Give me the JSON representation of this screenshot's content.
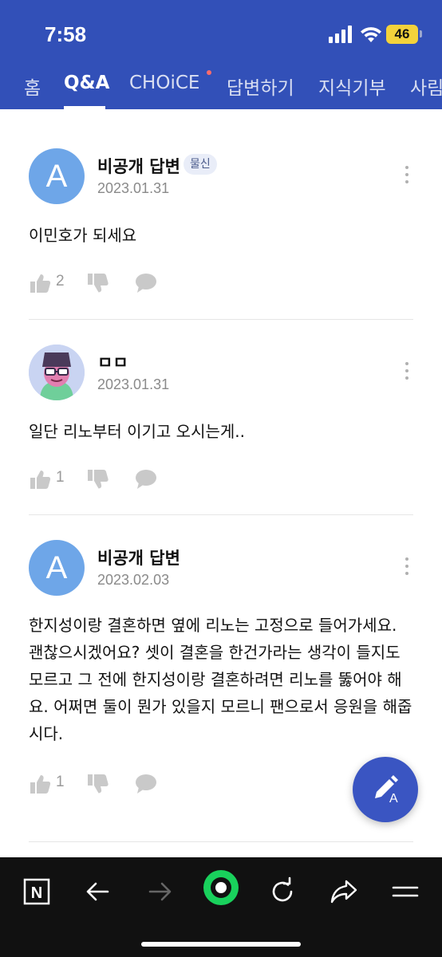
{
  "status_bar": {
    "time": "7:58",
    "battery": "46"
  },
  "tabs": [
    {
      "label": "홈",
      "active": false
    },
    {
      "label": "Q&A",
      "active": true
    },
    {
      "label": "CHOiCE",
      "active": false,
      "new_dot": true
    },
    {
      "label": "답변하기",
      "active": false
    },
    {
      "label": "지식기부",
      "active": false
    },
    {
      "label": "사림",
      "active": false
    }
  ],
  "answers": [
    {
      "avatar_letter": "A",
      "name": "비공개 답변",
      "badge": "물신",
      "date": "2023.01.31",
      "content": "이민호가 되세요",
      "likes": "2"
    },
    {
      "avatar_letter": "",
      "name": "ㅁㅁ",
      "badge": "",
      "date": "2023.01.31",
      "content": "일단 리노부터 이기고 오시는게..",
      "likes": "1"
    },
    {
      "avatar_letter": "A",
      "name": "비공개 답변",
      "badge": "",
      "date": "2023.02.03",
      "content": "한지성이랑 결혼하면 옆에 리노는 고정으로 들어가세요. 괜찮으시겠어요? 셋이 결혼을 한건가라는 생각이 들지도 모르고 그 전에 한지성이랑 결혼하려면 리노를 뚫어야 해요. 어쩌면 둘이 뭔가 있을지 모르니 팬으로서 응원을 해줍시다.",
      "likes": "1"
    }
  ],
  "fab": {
    "icon": "write-answer-icon",
    "letter": "A"
  },
  "toolbar": {
    "items": [
      "naver-n-icon",
      "back-icon",
      "forward-icon",
      "green-dot-icon",
      "reload-icon",
      "share-icon",
      "menu-icon"
    ],
    "n_label": "N"
  },
  "colors": {
    "header": "#3250b8",
    "avatar": "#6ea6e8",
    "fab": "#3a55c2",
    "green": "#19d15c"
  }
}
